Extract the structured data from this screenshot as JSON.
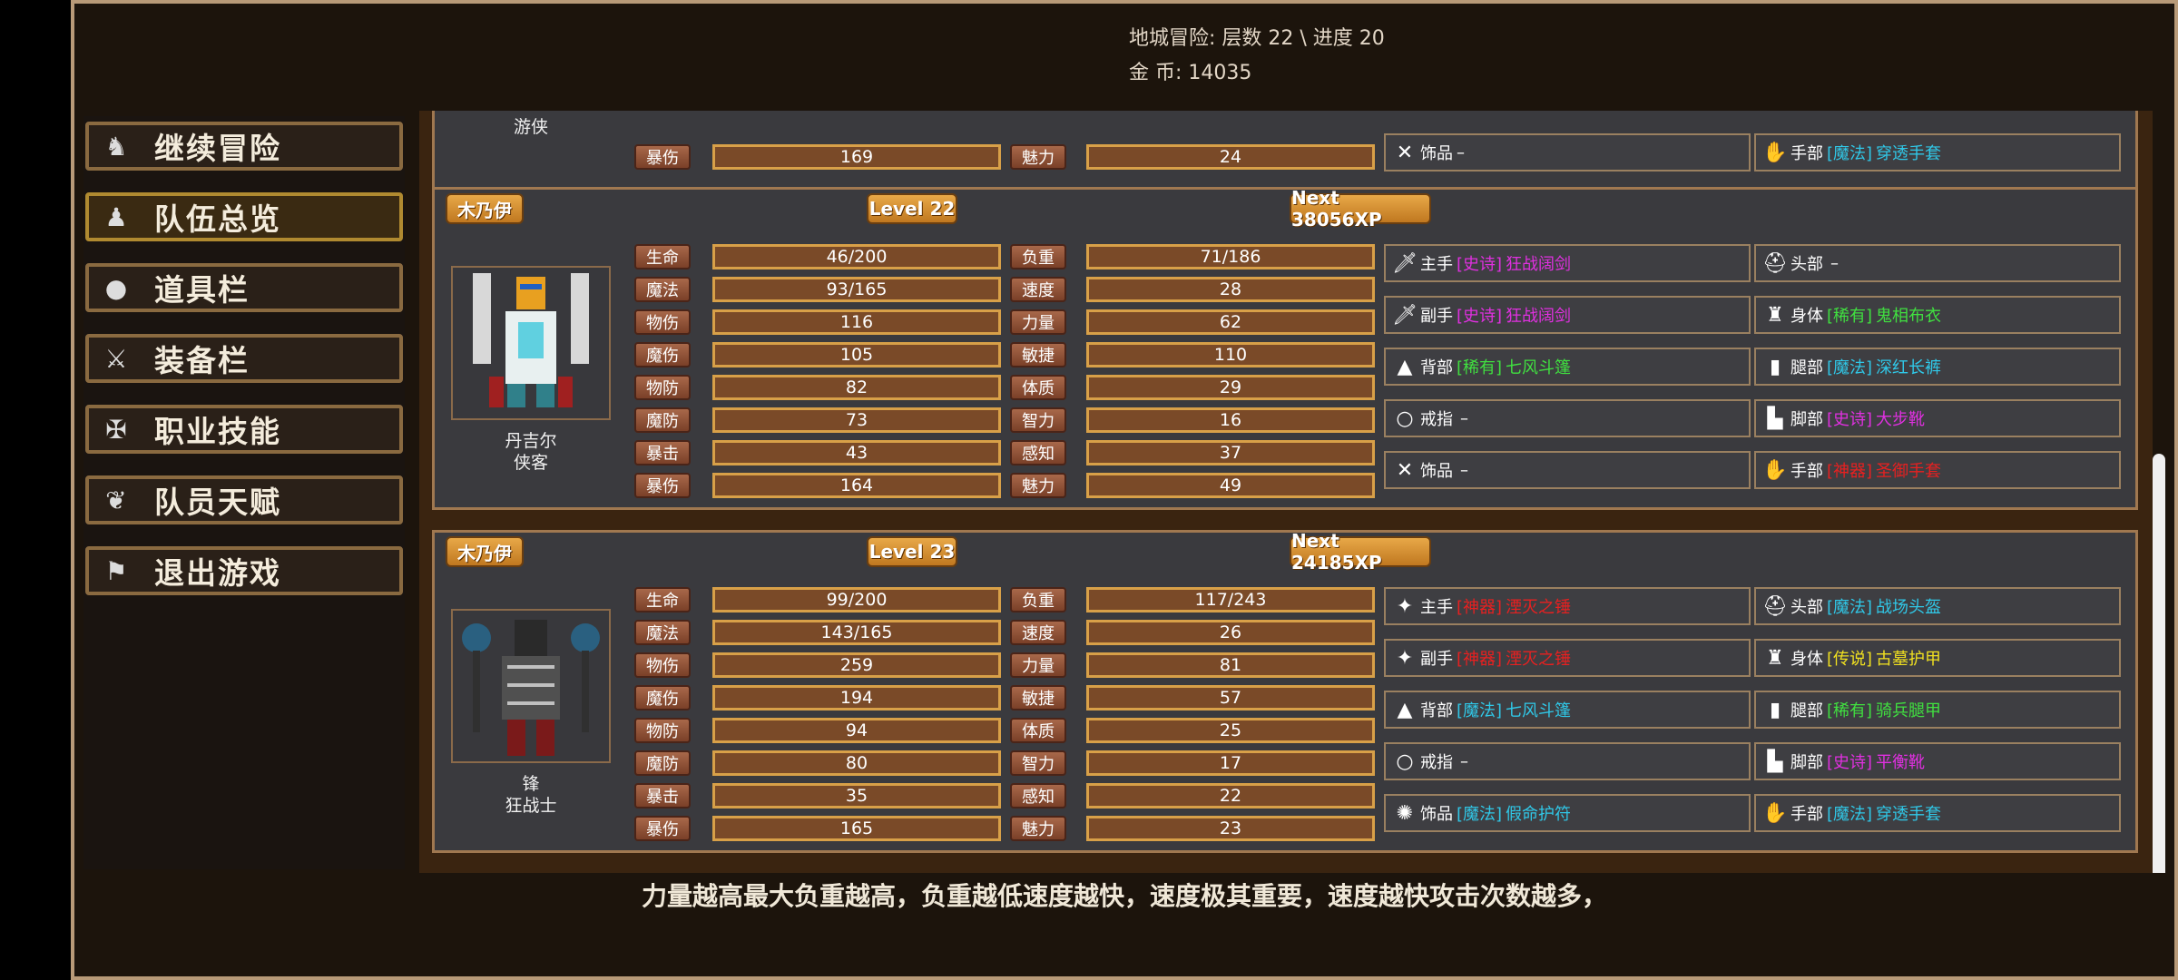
{
  "header": {
    "dungeon_label": "地城冒险: 层数 22 \\ 进度 20",
    "gold_label": "金    币: 14035"
  },
  "menu": {
    "items": [
      {
        "label": "继续冒险"
      },
      {
        "label": "队伍总览"
      },
      {
        "label": "道具栏"
      },
      {
        "label": "装备栏"
      },
      {
        "label": "职业技能"
      },
      {
        "label": "队员天赋"
      },
      {
        "label": "退出游戏"
      }
    ]
  },
  "top_partial": {
    "class_name": "游侠",
    "stat1_label": "暴伤",
    "stat1_value": "169",
    "stat2_label": "魅力",
    "stat2_value": "24",
    "eq_left": {
      "slot": "饰品",
      "quality": "",
      "name": "–"
    },
    "eq_right": {
      "slot": "手部",
      "quality": "[魔法]",
      "name": "穿透手套"
    }
  },
  "members": [
    {
      "race": "木乃伊",
      "level": "Level 22",
      "next_xp": "Next 38056XP",
      "name": "丹吉尔",
      "class_name": "侠客",
      "stats_left": [
        {
          "label": "生命",
          "value": "46/200"
        },
        {
          "label": "魔法",
          "value": "93/165"
        },
        {
          "label": "物伤",
          "value": "116"
        },
        {
          "label": "魔伤",
          "value": "105"
        },
        {
          "label": "物防",
          "value": "82"
        },
        {
          "label": "魔防",
          "value": "73"
        },
        {
          "label": "暴击",
          "value": "43"
        },
        {
          "label": "暴伤",
          "value": "164"
        }
      ],
      "stats_right": [
        {
          "label": "负重",
          "value": "71/186"
        },
        {
          "label": "速度",
          "value": "28"
        },
        {
          "label": "力量",
          "value": "62"
        },
        {
          "label": "敏捷",
          "value": "110"
        },
        {
          "label": "体质",
          "value": "29"
        },
        {
          "label": "智力",
          "value": "16"
        },
        {
          "label": "感知",
          "value": "37"
        },
        {
          "label": "魅力",
          "value": "49"
        }
      ],
      "equip_left": [
        {
          "slot": "主手",
          "quality": "[史诗]",
          "name": "狂战阔剑",
          "color": "#e030e0",
          "icon": "sword-icon"
        },
        {
          "slot": "副手",
          "quality": "[史诗]",
          "name": "狂战阔剑",
          "color": "#e030e0",
          "icon": "sword-icon"
        },
        {
          "slot": "背部",
          "quality": "[稀有]",
          "name": "七风斗篷",
          "color": "#40e040",
          "icon": "cloak-icon"
        },
        {
          "slot": "戒指",
          "quality": "",
          "name": "–",
          "color": "#ffffff",
          "icon": "ring-icon"
        },
        {
          "slot": "饰品",
          "quality": "",
          "name": "–",
          "color": "#ffffff",
          "icon": "crossed-tools-icon"
        }
      ],
      "equip_right": [
        {
          "slot": "头部",
          "quality": "",
          "name": "–",
          "color": "#ffffff",
          "icon": "helmet-icon"
        },
        {
          "slot": "身体",
          "quality": "[稀有]",
          "name": "鬼相布衣",
          "color": "#40e040",
          "icon": "armor-icon"
        },
        {
          "slot": "腿部",
          "quality": "[魔法]",
          "name": "深红长裤",
          "color": "#30c8e8",
          "icon": "legs-icon"
        },
        {
          "slot": "脚部",
          "quality": "[史诗]",
          "name": "大步靴",
          "color": "#e030e0",
          "icon": "boots-icon"
        },
        {
          "slot": "手部",
          "quality": "[神器]",
          "name": "圣御手套",
          "color": "#e82020",
          "icon": "glove-icon"
        }
      ]
    },
    {
      "race": "木乃伊",
      "level": "Level 23",
      "next_xp": "Next 24185XP",
      "name": "锋",
      "class_name": "狂战士",
      "stats_left": [
        {
          "label": "生命",
          "value": "99/200"
        },
        {
          "label": "魔法",
          "value": "143/165"
        },
        {
          "label": "物伤",
          "value": "259"
        },
        {
          "label": "魔伤",
          "value": "194"
        },
        {
          "label": "物防",
          "value": "94"
        },
        {
          "label": "魔防",
          "value": "80"
        },
        {
          "label": "暴击",
          "value": "35"
        },
        {
          "label": "暴伤",
          "value": "165"
        }
      ],
      "stats_right": [
        {
          "label": "负重",
          "value": "117/243"
        },
        {
          "label": "速度",
          "value": "26"
        },
        {
          "label": "力量",
          "value": "81"
        },
        {
          "label": "敏捷",
          "value": "57"
        },
        {
          "label": "体质",
          "value": "25"
        },
        {
          "label": "智力",
          "value": "17"
        },
        {
          "label": "感知",
          "value": "22"
        },
        {
          "label": "魅力",
          "value": "23"
        }
      ],
      "equip_left": [
        {
          "slot": "主手",
          "quality": "[神器]",
          "name": "湮灭之锤",
          "color": "#e82020",
          "icon": "mace-icon"
        },
        {
          "slot": "副手",
          "quality": "[神器]",
          "name": "湮灭之锤",
          "color": "#e82020",
          "icon": "mace-icon"
        },
        {
          "slot": "背部",
          "quality": "[魔法]",
          "name": "七风斗篷",
          "color": "#30c8e8",
          "icon": "cloak-icon"
        },
        {
          "slot": "戒指",
          "quality": "",
          "name": "–",
          "color": "#ffffff",
          "icon": "ring-icon"
        },
        {
          "slot": "饰品",
          "quality": "[魔法]",
          "name": "假命护符",
          "color": "#30c8e8",
          "icon": "amulet-icon"
        }
      ],
      "equip_right": [
        {
          "slot": "头部",
          "quality": "[魔法]",
          "name": "战场头盔",
          "color": "#30c8e8",
          "icon": "helmet-icon"
        },
        {
          "slot": "身体",
          "quality": "[传说]",
          "name": "古墓护甲",
          "color": "#f0e020",
          "icon": "armor-icon"
        },
        {
          "slot": "腿部",
          "quality": "[稀有]",
          "name": "骑兵腿甲",
          "color": "#40e040",
          "icon": "legs-icon"
        },
        {
          "slot": "脚部",
          "quality": "[史诗]",
          "name": "平衡靴",
          "color": "#e030e0",
          "icon": "boots-icon"
        },
        {
          "slot": "手部",
          "quality": "[魔法]",
          "name": "穿透手套",
          "color": "#30c8e8",
          "icon": "glove-icon"
        }
      ]
    }
  ],
  "footer": {
    "hint": "力量越高最大负重越高，负重越低速度越快，速度极其重要，速度越快攻击次数越多，"
  }
}
